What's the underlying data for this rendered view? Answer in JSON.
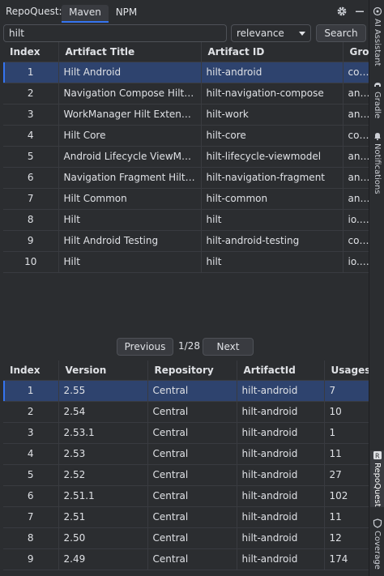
{
  "header": {
    "app_name": "RepoQuest:",
    "tabs": [
      {
        "label": "Maven",
        "active": true
      },
      {
        "label": "NPM",
        "active": false
      }
    ]
  },
  "search": {
    "query": "hilt",
    "sort_value": "relevance",
    "button_label": "Search"
  },
  "artifacts_table": {
    "columns": [
      "Index",
      "Artifact Title",
      "Artifact ID",
      "Grou"
    ],
    "rows": [
      {
        "index": "1",
        "title": "Hilt Android",
        "id": "hilt-android",
        "group": "com.g",
        "selected": true
      },
      {
        "index": "2",
        "title": "Navigation Compose Hilt Inte...",
        "id": "hilt-navigation-compose",
        "group": "andro"
      },
      {
        "index": "3",
        "title": "WorkManager Hilt Extension",
        "id": "hilt-work",
        "group": "andro"
      },
      {
        "index": "4",
        "title": "Hilt Core",
        "id": "hilt-core",
        "group": "com.g"
      },
      {
        "index": "5",
        "title": "Android Lifecycle ViewModel ...",
        "id": "hilt-lifecycle-viewmodel",
        "group": "andro"
      },
      {
        "index": "6",
        "title": "Navigation Fragment Hilt Ext...",
        "id": "hilt-navigation-fragment",
        "group": "andro"
      },
      {
        "index": "7",
        "title": "Hilt Common",
        "id": "hilt-common",
        "group": "andro"
      },
      {
        "index": "8",
        "title": "Hilt",
        "id": "hilt",
        "group": "io.pix"
      },
      {
        "index": "9",
        "title": "Hilt Android Testing",
        "id": "hilt-android-testing",
        "group": "com.g"
      },
      {
        "index": "10",
        "title": "Hilt",
        "id": "hilt",
        "group": "io.pix"
      }
    ]
  },
  "pagination": {
    "prev_label": "Previous",
    "page_label": "1/28",
    "next_label": "Next"
  },
  "versions_table": {
    "columns": [
      "Index",
      "Version",
      "Repository",
      "ArtifactId",
      "Usages"
    ],
    "rows": [
      {
        "index": "1",
        "version": "2.55",
        "repository": "Central",
        "artifact": "hilt-android",
        "usages": "7",
        "selected": true
      },
      {
        "index": "2",
        "version": "2.54",
        "repository": "Central",
        "artifact": "hilt-android",
        "usages": "10"
      },
      {
        "index": "3",
        "version": "2.53.1",
        "repository": "Central",
        "artifact": "hilt-android",
        "usages": "1"
      },
      {
        "index": "4",
        "version": "2.53",
        "repository": "Central",
        "artifact": "hilt-android",
        "usages": "11"
      },
      {
        "index": "5",
        "version": "2.52",
        "repository": "Central",
        "artifact": "hilt-android",
        "usages": "27"
      },
      {
        "index": "6",
        "version": "2.51.1",
        "repository": "Central",
        "artifact": "hilt-android",
        "usages": "102"
      },
      {
        "index": "7",
        "version": "2.51",
        "repository": "Central",
        "artifact": "hilt-android",
        "usages": "11"
      },
      {
        "index": "8",
        "version": "2.50",
        "repository": "Central",
        "artifact": "hilt-android",
        "usages": "12"
      },
      {
        "index": "9",
        "version": "2.49",
        "repository": "Central",
        "artifact": "hilt-android",
        "usages": "174"
      }
    ]
  },
  "sidebar": {
    "items": [
      {
        "label": "AI Assistant",
        "icon": "ai-assistant-icon"
      },
      {
        "label": "Gradle",
        "icon": "gradle-icon"
      },
      {
        "label": "Notifications",
        "icon": "bell-icon"
      },
      {
        "label": "RepoQuest",
        "icon": "repoquest-icon",
        "active": true
      },
      {
        "label": "Coverage",
        "icon": "shield-icon"
      }
    ]
  },
  "colors": {
    "background": "#2b2d30",
    "selection": "#2e436e",
    "accent": "#3574f0",
    "border": "#393b40"
  }
}
